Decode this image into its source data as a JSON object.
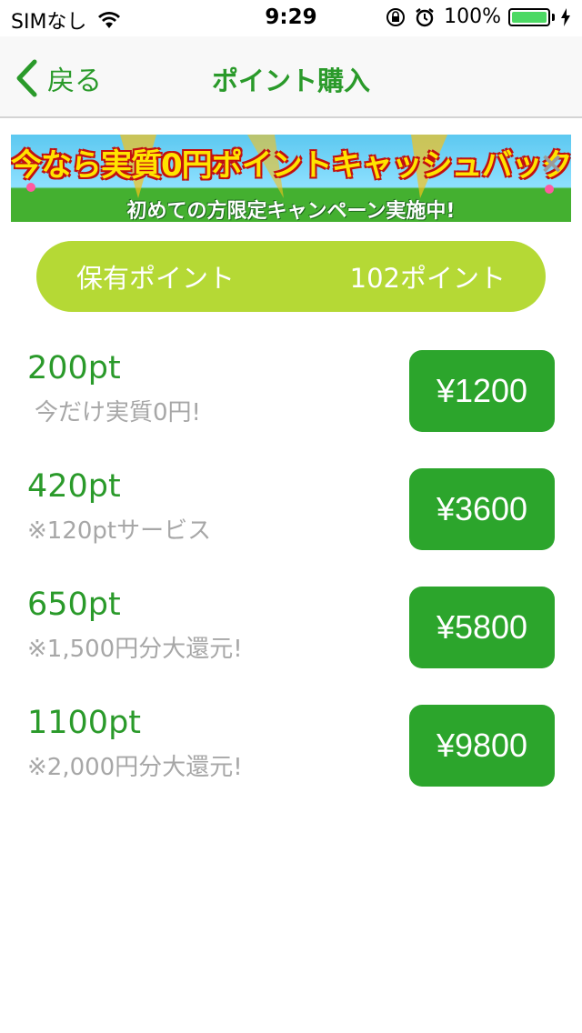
{
  "status_bar": {
    "carrier": "SIMなし",
    "time": "9:29",
    "battery": "100%"
  },
  "nav": {
    "back_label": "戻る",
    "title": "ポイント購入"
  },
  "banner": {
    "title": "今なら実質0円ポイントキャッシュバック!",
    "subtitle": "初めての方限定キャンペーン実施中!"
  },
  "points": {
    "label": "保有ポイント",
    "value": "102ポイント"
  },
  "plans": [
    {
      "points": "200pt",
      "note": "今だけ実質0円!",
      "price": "¥1200"
    },
    {
      "points": "420pt",
      "note": "※120ptサービス",
      "price": "¥3600"
    },
    {
      "points": "650pt",
      "note": "※1,500円分大還元!",
      "price": "¥5800"
    },
    {
      "points": "1100pt",
      "note": "※2,000円分大還元!",
      "price": "¥9800"
    }
  ],
  "colors": {
    "accent_green": "#2a9a2a",
    "button_green": "#2ca52c",
    "pill_lime": "#b5d935",
    "note_gray": "#a7a7a7"
  }
}
